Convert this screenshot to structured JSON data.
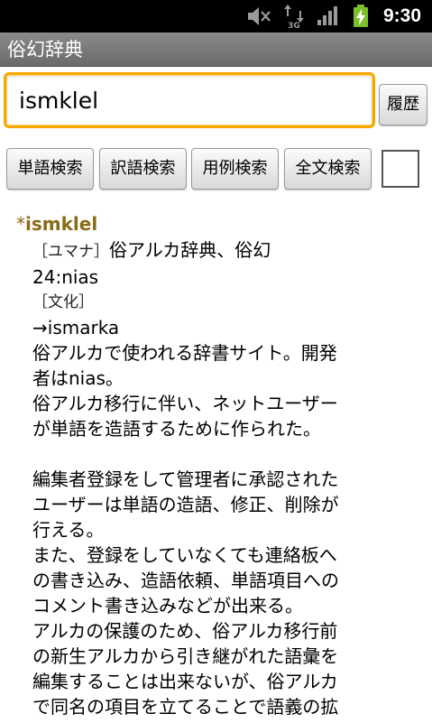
{
  "status_bar": {
    "time": "9:30",
    "icons": [
      "mute-icon",
      "3g-icon",
      "signal-icon",
      "battery-charging-icon"
    ]
  },
  "app": {
    "title": "俗幻辞典"
  },
  "search": {
    "value": "ismklel",
    "history_label": "履歴"
  },
  "buttons": {
    "word": "単語検索",
    "translation": "訳語検索",
    "example": "用例検索",
    "fulltext": "全文検索"
  },
  "checkbox": {
    "checked": false
  },
  "entry": {
    "star": "*",
    "word": "ismklel",
    "usage_tag": "［ユマナ］",
    "translation": "俗アルカ辞典、俗幻",
    "info": "24:nias",
    "culture_tag": "［文化］",
    "reference": "→ismarka",
    "body_lines": [
      "俗アルカで使われる辞書サイト。開発",
      "者はnias。",
      "俗アルカ移行に伴い、ネットユーザー",
      "が単語を造語するために作られた。",
      "",
      "編集者登録をして管理者に承認された",
      "ユーザーは単語の造語、修正、削除が",
      "行える。",
      "また、登録をしていなくても連絡板へ",
      "の書き込み、造語依頼、単語項目への",
      "コメント書き込みなどが出来る。",
      "アルカの保護のため、俗アルカ移行前",
      "の新生アルカから引き継がれた語彙を",
      "編集することは出来ないが、俗アルカ",
      "で同名の項目を立てることで語義の拡"
    ]
  },
  "colors": {
    "accent_focus": "#f6a800",
    "headword": "#8b6b14",
    "title_bar": "#7a7a7a"
  }
}
